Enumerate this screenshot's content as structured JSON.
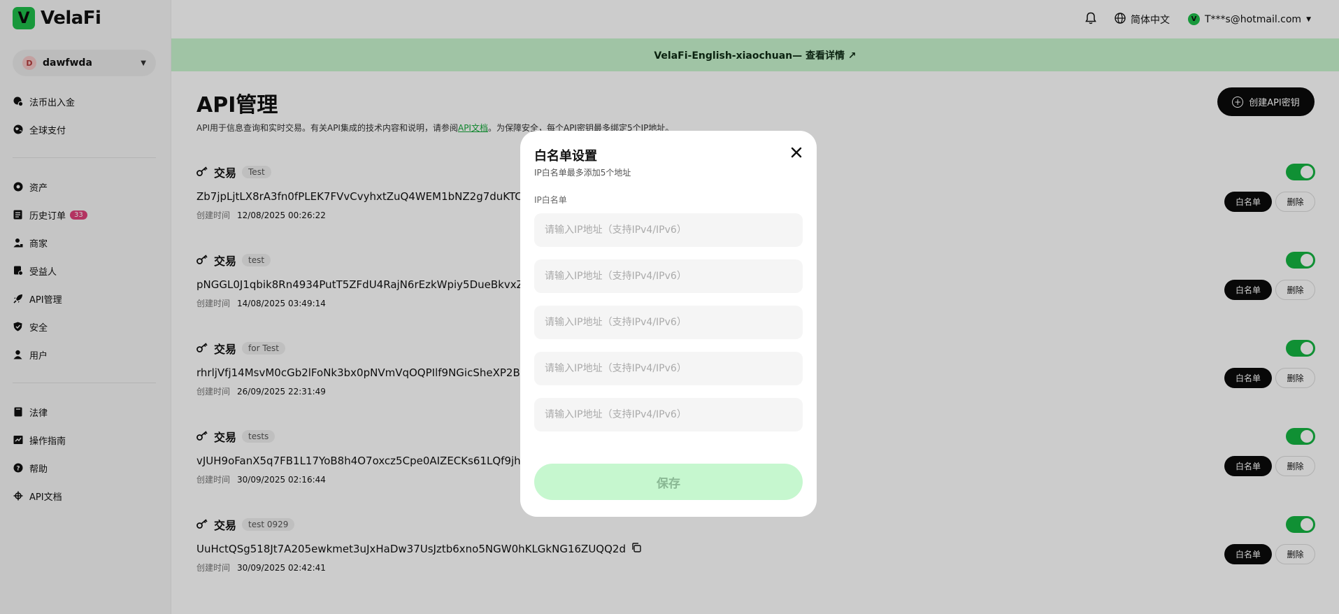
{
  "app": {
    "logo_letter": "V",
    "name": "VelaFi"
  },
  "account": {
    "avatar_letter": "D",
    "name": "dawfwda"
  },
  "nav_top": [
    {
      "label": "法币出入金",
      "icon": "fiat-exchange-icon"
    },
    {
      "label": "全球支付",
      "icon": "globe-payment-icon"
    }
  ],
  "nav_main": [
    {
      "label": "资产",
      "icon": "assets-icon"
    },
    {
      "label": "历史订单",
      "icon": "orders-icon",
      "badge": "33"
    },
    {
      "label": "商家",
      "icon": "merchant-icon"
    },
    {
      "label": "受益人",
      "icon": "beneficiary-icon"
    },
    {
      "label": "API管理",
      "icon": "api-rocket-icon"
    },
    {
      "label": "安全",
      "icon": "shield-icon"
    },
    {
      "label": "用户",
      "icon": "user-icon"
    }
  ],
  "nav_bottom": [
    {
      "label": "法律",
      "icon": "law-book-icon"
    },
    {
      "label": "操作指南",
      "icon": "guide-icon"
    },
    {
      "label": "帮助",
      "icon": "help-icon"
    },
    {
      "label": "API文档",
      "icon": "api-doc-icon"
    }
  ],
  "topbar": {
    "language": "简体中文",
    "user_letter": "V",
    "user_email": "T***s@hotmail.com"
  },
  "banner": {
    "text": "VelaFi-English-xiaochuan— 查看详情 ↗"
  },
  "page": {
    "title": "API管理",
    "desc_before": "API用于信息查询和实时交易。有关API集成的技术内容和说明，请参阅",
    "desc_link": "API文档",
    "desc_after": "。为保障安全，每个API密钥最多绑定5个IP地址。",
    "create_button": "创建API密钥"
  },
  "labels": {
    "created": "创建时间",
    "whitelist": "白名单",
    "delete": "删除"
  },
  "keys": [
    {
      "type": "交易",
      "tag": "Test",
      "key": "Zb7jpLjtLX8rA3fn0fPLEK7FVvCvyhxtZuQ4WEM1bNZ2g7duKTCCc",
      "created": "12/08/2025 00:26:22",
      "enabled": true
    },
    {
      "type": "交易",
      "tag": "test",
      "key": "pNGGL0J1qbik8Rn4934PutT5ZFdU4RajN6rEzkWpiy5DueBkvxZ6",
      "created": "14/08/2025 03:49:14",
      "enabled": true
    },
    {
      "type": "交易",
      "tag": "for Test",
      "key": "rhrljVfj14MsvM0cGb2lFoNk3bx0pNVmVqOQPIlf9NGicSheXP2BD",
      "created": "26/09/2025 22:31:49",
      "enabled": true
    },
    {
      "type": "交易",
      "tag": "tests",
      "key": "vJUH9oFanX5q7FB1L17YoB8h4O7oxcz5Cpe0AIZECKs61LQf9jhL9",
      "created": "30/09/2025 02:16:44",
      "enabled": true
    },
    {
      "type": "交易",
      "tag": "test 0929",
      "key": "UuHctQSg518Jt7A205ewkmet3uJxHaDw37UsJztb6xno5NGW0hKLGkNG16ZUQQ2d",
      "created": "30/09/2025 02:42:41",
      "enabled": true
    }
  ],
  "modal": {
    "title": "白名单设置",
    "subtitle": "IP白名单最多添加5个地址",
    "field_label": "IP白名单",
    "placeholder": "请输入IP地址（支持IPv4/IPv6）",
    "inputs": [
      "",
      "",
      "",
      "",
      ""
    ],
    "save_button": "保存"
  },
  "colors": {
    "brand": "#1fbf4a",
    "banner": "#c9f5cf",
    "toggle_on": "#14b441",
    "save_disabled": "#c6f7cf",
    "badge": "#e0407a"
  }
}
